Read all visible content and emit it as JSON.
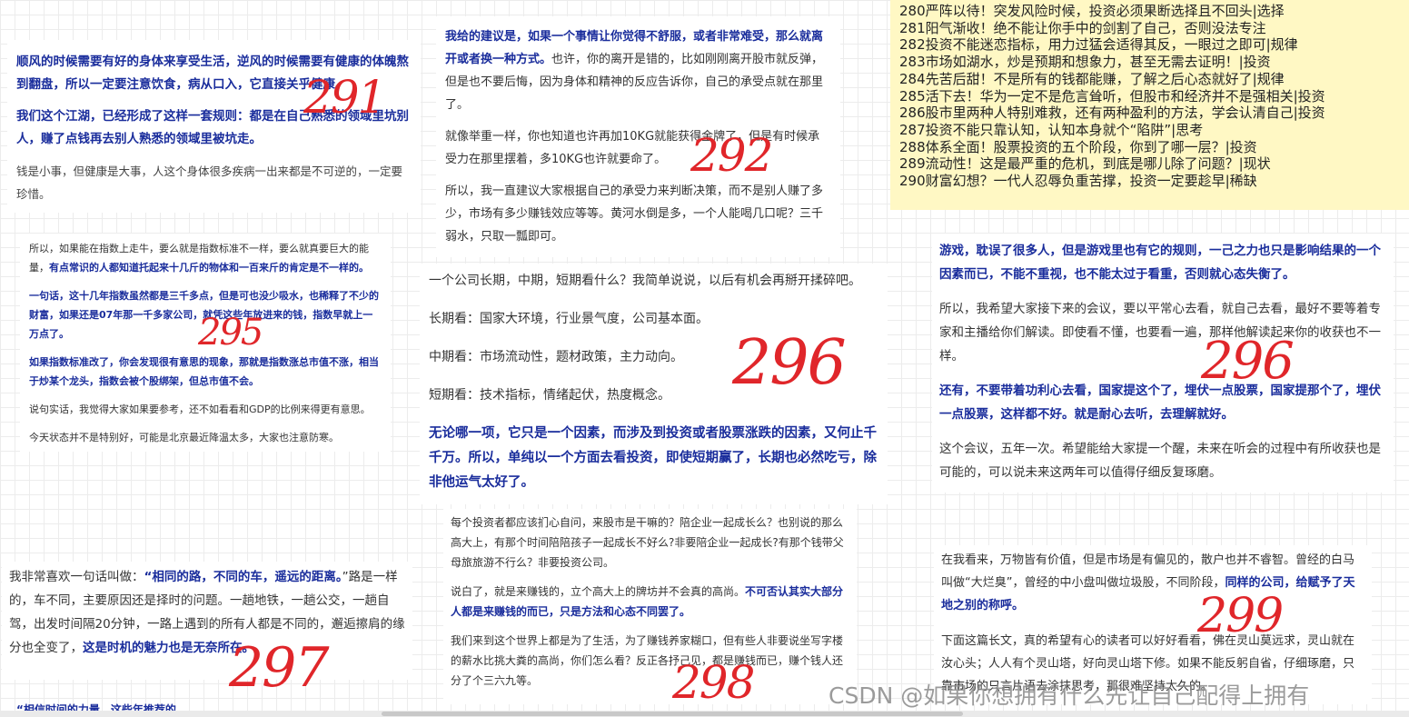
{
  "list": {
    "items": [
      "280严阵以待！突发风险时候，投资必须果断选择且不回头|选择",
      "281阳气渐收！绝不能让你手中的剑割了自己，否则没法专注",
      "282投资不能迷恋指标，用力过猛会适得其反，一眼过之即可|规律",
      "283市场如湖水，炒是预期和想象力，甚至无需去证明！|投资",
      "284先苦后甜！不是所有的钱都能赚，了解之后心态就好了|规律",
      "285活下去！华为一定不是危言耸听，但股市和经济并不是强相关|投资",
      "286股市里两种人特别难救，还有两种盈利的方法，学会认清自己|投资",
      "287投资不能只靠认知，认知本身就个“陷阱”|思考",
      "288体系全面！股票投资的五个阶段，你到了哪一层？|投资",
      "289流动性！这是最严重的危机，到底是哪儿除了问题？|现状",
      "290财富幻想？一代人忍辱负重苦撑，投资一定要趁早|稀缺"
    ]
  },
  "c291": {
    "p1": "顺风的时候需要有好的身体来享受生活，逆风的时候需要有健康的体魄熬到翻盘，所以一定要注意饮食，病从口入，它直接关乎健康。",
    "p2": "我们这个江湖，已经形成了这样一套规则：都是在自己熟悉的领域里坑别人，赚了点钱再去别人熟悉的领域里被坑走。",
    "p3": "钱是小事，但健康是大事，人这个身体很多疾病一出来都是不可逆的，一定要珍惜。",
    "num": "291"
  },
  "c292": {
    "p1a": "我给的建议是，如果一个事情让你觉得不舒服，或者非常难受，那么就离开或者换一种方式。",
    "p1b": "也许，你的离开是错的，比如刚刚离开股市就反弹，但是也不要后悔，因为身体和精神的反应告诉你，自己的承受点就在那里了。",
    "p2": "就像举重一样，你也知道也许再加10KG就能获得金牌了，但是有时候承受力在那里摆着，多10KG也许就要命了。",
    "p3": "所以，我一直建议大家根据自己的承受力来判断决策，而不是别人赚了多少，市场有多少赚钱效应等等。黄河水倒是多，一个人能喝几口呢？三千弱水，只取一瓢即可。",
    "num": "292"
  },
  "c295": {
    "p1a": "所以，如果能在指数上走牛，要么就是指数标准不一样，要么就真要巨大的能量，",
    "p1b": "有点常识的人都知道托起来十几斤的物体和一百来斤的肯定是不一样的。",
    "p2": "一句话，这十几年指数虽然都是三千多点，但是可也没少吸水，也稀释了不少的财富，如果还是07年那一千多家公司，就凭这些年放进来的钱，指数早就上一万点了。",
    "p3": "如果指数标准改了，你会发现很有意思的现象，那就是指数涨总市值不涨，相当于炒某个龙头，指数会被个股绑架，但总市值不会。",
    "p4": "说句实话，我觉得大家如果要参考，还不如看看和GDP的比例来得更有意思。",
    "p5": "今天状态并不是特别好，可能是北京最近降温太多，大家也注意防寒。",
    "num": "295"
  },
  "c296a": {
    "p1": "一个公司长期，中期，短期看什么？我简单说说，以后有机会再掰开揉碎吧。",
    "p2": "长期看：国家大环境，行业景气度，公司基本面。",
    "p3": "中期看：市场流动性，题材政策，主力动向。",
    "p4": "短期看：技术指标，情绪起伏，热度概念。",
    "p5": "无论哪一项，它只是一个因素，而涉及到投资或者股票涨跌的因素，又何止千千万。所以，单纯以一个方面去看投资，即使短期赢了，长期也必然吃亏，除非他运气太好了。",
    "num": "296"
  },
  "c296b": {
    "p1": "游戏，耽误了很多人，但是游戏里也有它的规则，一己之力也只是影响结果的一个因素而已，不能不重视，也不能太过于看重，否则就心态失衡了。",
    "p2": "所以，我希望大家接下来的会议，要以平常心去看，就自己去看，最好不要等着专家和主播给你们解读。即使看不懂，也要看一遍，那样他解读起来你的收获也不一样。",
    "p3": "还有，不要带着功利心去看，国家提这个了，埋伏一点股票，国家提那个了，埋伏一点股票，这样都不好。就是耐心去听，去理解就好。",
    "p4": "这个会议，五年一次。希望能给大家提一个醒，未来在听会的过程中有所收获也是可能的，可以说未来这两年可以值得仔细反复琢磨。",
    "num": "296"
  },
  "c297": {
    "p1a": "我非常喜欢一句话叫做：",
    "p1b": "“相同的路，不同的车，遥远的距离。",
    "p1c": "”路是一样的，车不同，主要原因还是择时的问题。一趟地铁，一趟公交，一趟自驾，出发时间隔20分钟，一路上遇到的所有人都是不同的，邂逅擦肩的缘分也全变了，",
    "p1d": "这是时机的魅力也是无奈所在。",
    "num": "297"
  },
  "c298": {
    "p1": "每个投资者都应该扪心自问，来股市是干嘛的？陪企业一起成长么？也别说的那么高大上，有那个时间陪陪孩子一起成长不好么?非要陪企业一起成长?有那个钱带父母旅旅游不行么？非要投资公司。",
    "p2a": "说白了，就是来赚钱的，立个高大上的牌坊并不会真的高尚。",
    "p2b": "不可否认其实大部分人都是来赚钱的而已，只是方法和心态不同罢了。",
    "p3": "我们来到这个世界上都是为了生活，为了赚钱养家糊口，但有些人非要说坐写字楼的薪水比挑大粪的高尚，你们怎么看？反正各抒己见，都是赚钱而已，赚个钱人还分了个三六九等。",
    "num": "298"
  },
  "c299": {
    "p1a": "在我看来，万物皆有价值，但是市场是有偏见的，散户也并不睿智。曾经的白马叫做“大烂臭”，曾经的中小盘叫做垃圾股，不同阶段，",
    "p1b": "同样的公司，给赋予了天地之别的称呼。",
    "p2": "下面这篇长文，真的希望有心的读者可以好好看看，佛在灵山莫远求，灵山就在汝心头；人人有个灵山塔，好向灵山塔下修。如果不能反躬自省，仔细琢磨，只靠市场的只言片语去涂抹思考，那很难坚持太久的。",
    "num": "299"
  },
  "bottom_fragment": "“相信时间的力量，这些年推荐的...",
  "watermark": "CSDN @如果你想拥有什么先让自己配得上拥有"
}
